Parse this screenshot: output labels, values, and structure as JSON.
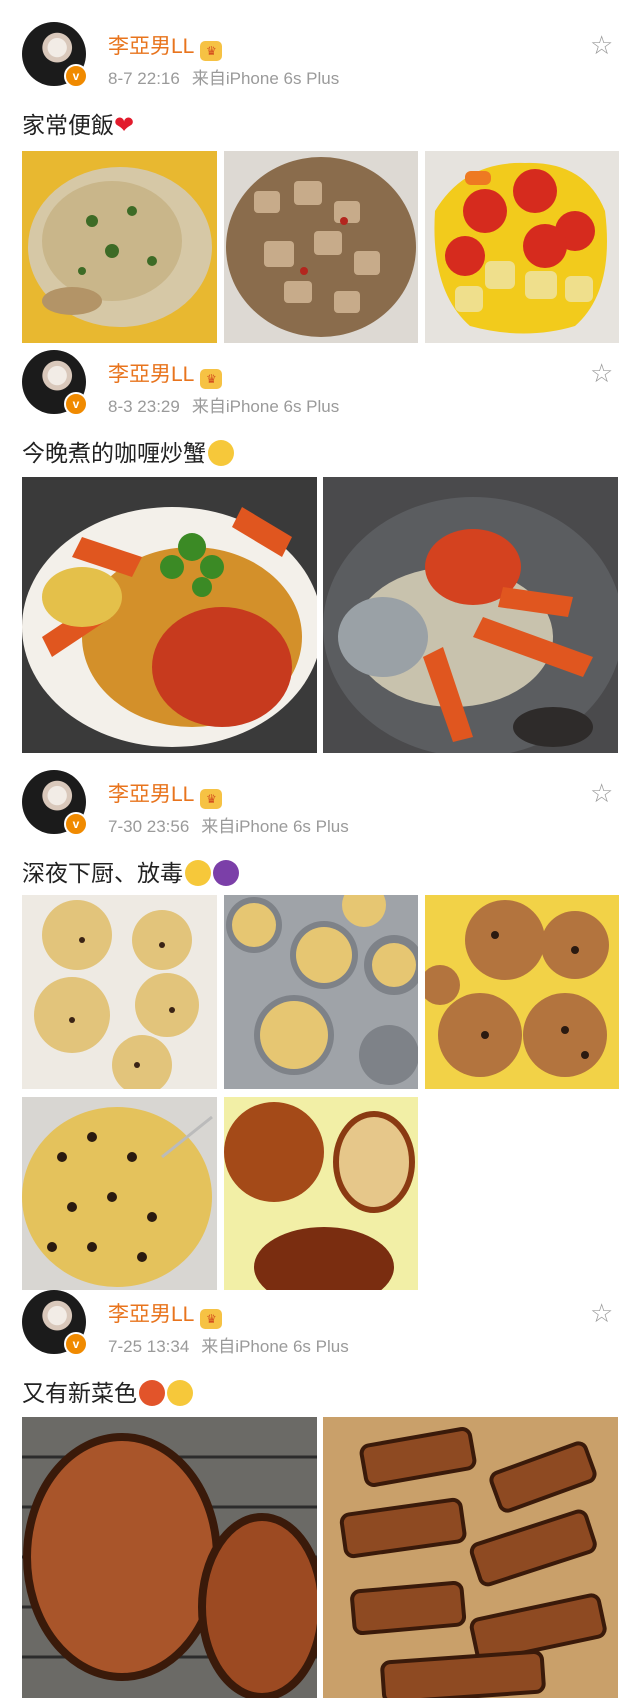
{
  "posts": [
    {
      "username": "李亞男LL",
      "date": "8-7 22:16",
      "source": "来自iPhone 6s Plus",
      "caption": "家常便飯"
    },
    {
      "username": "李亞男LL",
      "date": "8-3 23:29",
      "source": "来自iPhone 6s Plus",
      "caption": "今晚煮的咖喱炒蟹"
    },
    {
      "username": "李亞男LL",
      "date": "7-30 23:56",
      "source": "来自iPhone 6s Plus",
      "caption": "深夜下厨、放毒"
    },
    {
      "username": "李亞男LL",
      "date": "7-25 13:34",
      "source": "来自iPhone 6s Plus",
      "caption": "又有新菜色"
    }
  ],
  "colors": {
    "username": "#e8741d",
    "meta": "#9a9a9a",
    "verified_badge": "#f08a00"
  }
}
